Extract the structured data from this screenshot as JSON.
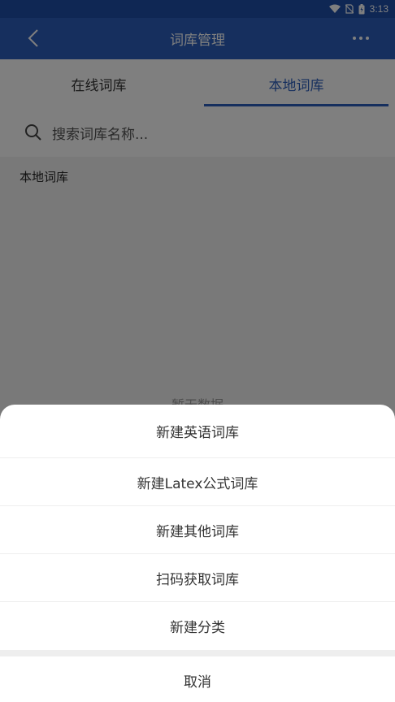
{
  "status_bar": {
    "time": "3:13"
  },
  "header": {
    "title": "词库管理"
  },
  "tabs": [
    {
      "label": "在线词库",
      "active": false
    },
    {
      "label": "本地词库",
      "active": true
    }
  ],
  "search": {
    "placeholder": "搜索词库名称..."
  },
  "content": {
    "section_label": "本地词库",
    "empty_text": "暂无数据"
  },
  "sheet": {
    "items": [
      {
        "label": "新建英语词库"
      },
      {
        "label": "新建Latex公式词库"
      },
      {
        "label": "新建其他词库"
      },
      {
        "label": "扫码获取词库"
      },
      {
        "label": "新建分类"
      }
    ],
    "cancel_label": "取消"
  },
  "colors": {
    "header": "#2c5fbd",
    "status_bar": "#1f4fa8",
    "accent": "#2c5fbd"
  }
}
